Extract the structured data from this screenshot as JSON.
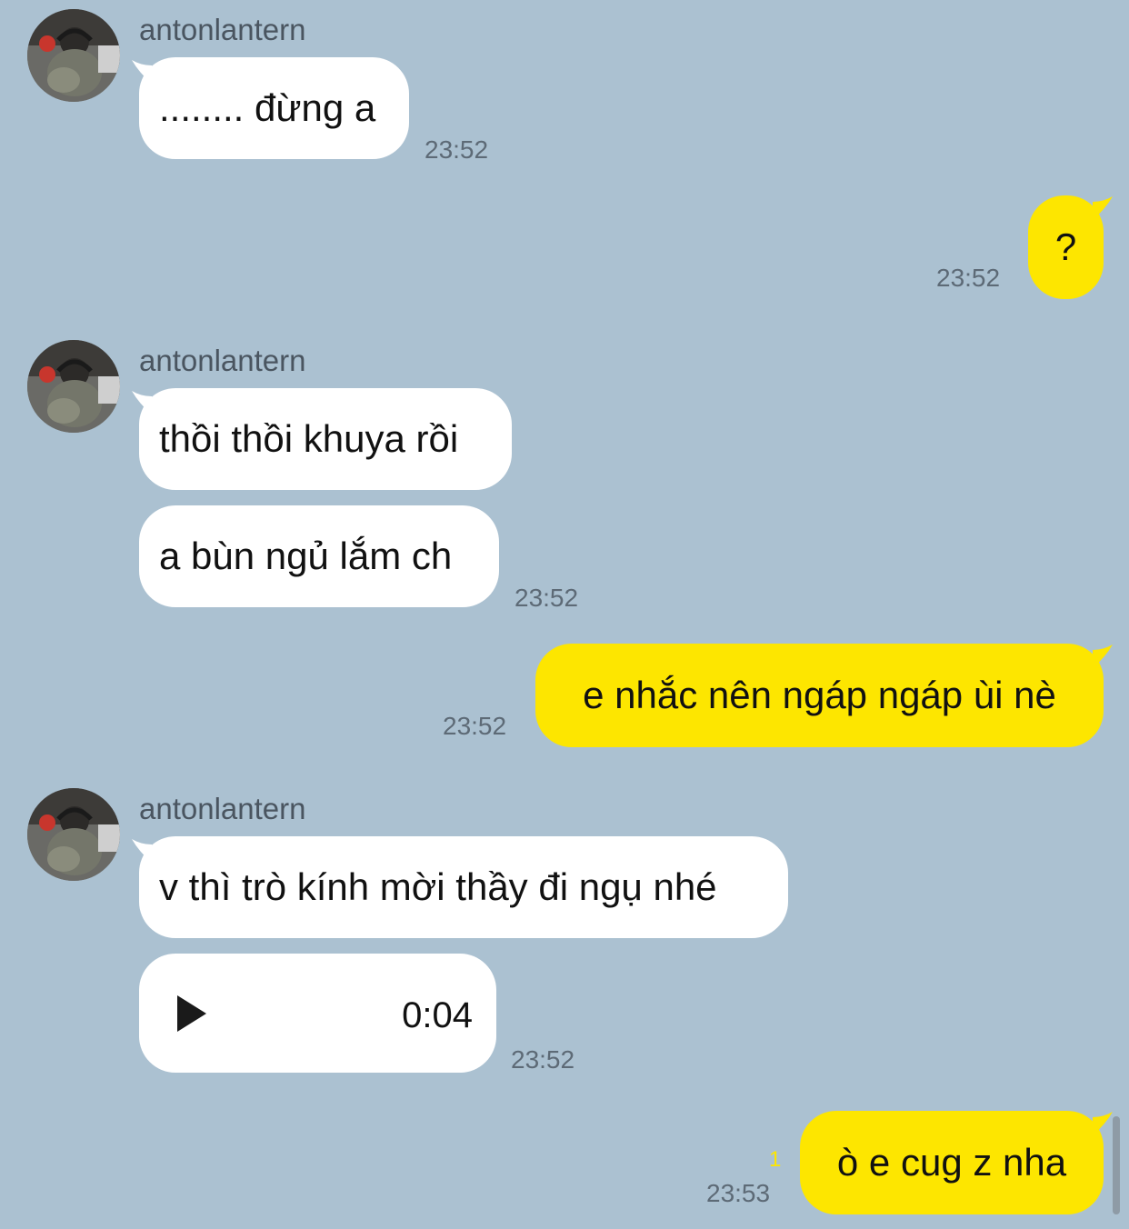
{
  "chat": {
    "groups": [
      {
        "sender": "antonlantern",
        "messages": [
          {
            "text": "........ đừng a"
          }
        ],
        "time": "23:52"
      },
      {
        "sender": "antonlantern",
        "messages": [
          {
            "text": "thồi thồi khuya rồi"
          },
          {
            "text": "a bùn ngủ lắm ch"
          }
        ],
        "time": "23:52"
      },
      {
        "sender": "antonlantern",
        "messages": [
          {
            "text": "v thì trò kính mời thầy đi ngụ nhé"
          }
        ],
        "voice_message": {
          "duration": "0:04",
          "icon": "play-icon"
        },
        "time": "23:52"
      }
    ],
    "outgoing": [
      {
        "text": "?",
        "time": "23:52"
      },
      {
        "text": "e nhắc nên ngáp ngáp ùi nè",
        "time": "23:52"
      },
      {
        "text": "ò e cug z nha",
        "time": "23:53",
        "unread_count": "1"
      }
    ]
  },
  "colors": {
    "background": "#abc1d1",
    "incoming_bubble": "#ffffff",
    "outgoing_bubble": "#fde600",
    "unread": "#fde600"
  }
}
